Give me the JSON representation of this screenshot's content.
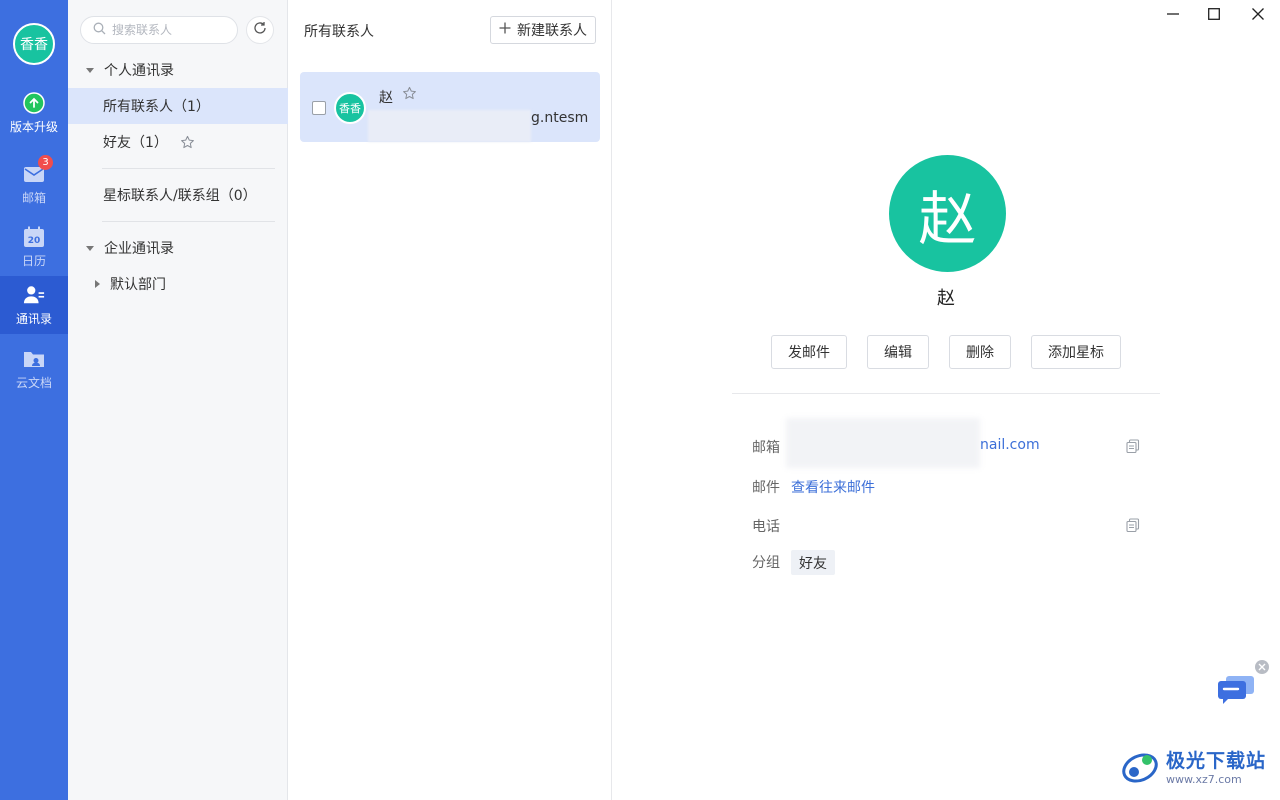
{
  "user": {
    "avatar_text": "香香"
  },
  "rail": {
    "items": [
      {
        "label": "版本升级"
      },
      {
        "label": "邮箱",
        "badge": "3"
      },
      {
        "label": "日历",
        "icon_text": "20"
      },
      {
        "label": "通讯录"
      },
      {
        "label": "云文档"
      }
    ]
  },
  "tree": {
    "search_placeholder": "搜索联系人",
    "personal_section": "个人通讯录",
    "all_contacts": "所有联系人（1）",
    "friends": "好友（1）",
    "starred": "星标联系人/联系组（0）",
    "enterprise_section": "企业通讯录",
    "default_dept": "默认部门"
  },
  "list": {
    "title": "所有联系人",
    "new_contact_label": "新建联系人",
    "contacts": [
      {
        "avatar_text": "香香",
        "name": "赵",
        "email_fragment": "g.ntesmail.com"
      }
    ]
  },
  "detail": {
    "avatar_text": "赵",
    "name": "赵",
    "buttons": {
      "send": "发邮件",
      "edit": "编辑",
      "delete": "删除",
      "star": "添加星标"
    },
    "fields": {
      "email_label": "邮箱",
      "email_value": "nail.com",
      "mail_label": "邮件",
      "mail_link": "查看往来邮件",
      "phone_label": "电话",
      "group_label": "分组",
      "group_value": "好友"
    }
  },
  "watermark": {
    "title": "极光下载站",
    "url": "www.xz7.com"
  },
  "colors": {
    "rail": "#3d6fe0",
    "rail_active": "#2c5bd2",
    "avatar": "#18c3a0",
    "selection": "#dbe5fb",
    "link": "#3c6fd8"
  }
}
